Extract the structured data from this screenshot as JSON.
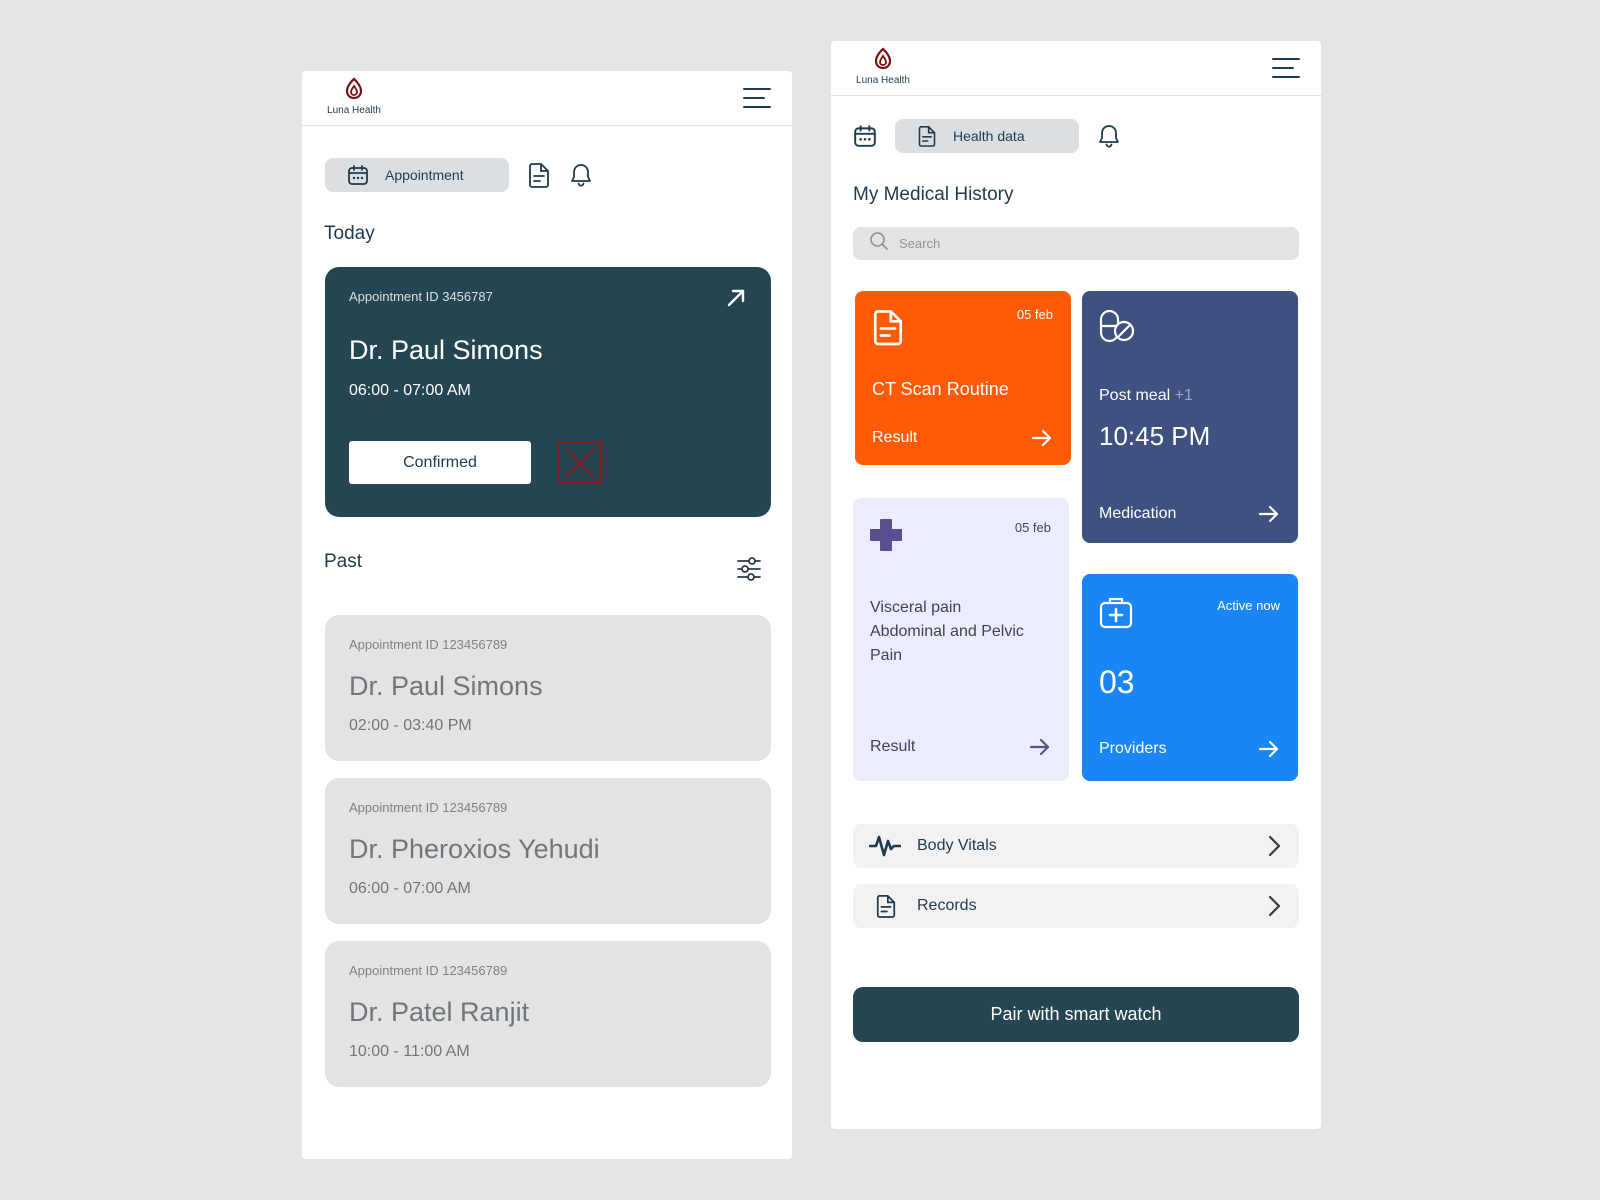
{
  "brand": {
    "name": "Luna Health",
    "logo_color": "#7a1010"
  },
  "colors": {
    "dark_teal": "#254552",
    "orange": "#ff5a06",
    "indigo": "#3f5180",
    "lavender": "#ecedfc",
    "blue": "#1a86f5",
    "cancel_red": "#8b1a1a"
  },
  "left": {
    "tabs": {
      "active_label": "Appointment",
      "active_icon": "calendar-icon",
      "other_icons": [
        "document-icon",
        "bell-icon"
      ]
    },
    "today_title": "Today",
    "today_card": {
      "appointment_id": "Appointment ID 3456787",
      "doctor": "Dr. Paul Simons",
      "time": "06:00 - 07:00 AM",
      "status_label": "Confirmed"
    },
    "past_title": "Past",
    "past": [
      {
        "appointment_id": "Appointment ID 123456789",
        "doctor": "Dr. Paul Simons",
        "time": "02:00 - 03:40 PM"
      },
      {
        "appointment_id": "Appointment ID 123456789",
        "doctor": "Dr. Pheroxios Yehudi",
        "time": "06:00 - 07:00 AM"
      },
      {
        "appointment_id": "Appointment ID 123456789",
        "doctor": "Dr. Patel Ranjit",
        "time": "10:00 - 11:00 AM"
      }
    ]
  },
  "right": {
    "tabs": {
      "active_label": "Health data",
      "active_icon": "document-icon",
      "other_icons": [
        "calendar-icon",
        "bell-icon"
      ]
    },
    "title": "My Medical History",
    "search": {
      "placeholder": "Search",
      "value": ""
    },
    "tiles": {
      "ct_scan": {
        "date": "05 feb",
        "title": "CT Scan Routine",
        "action": "Result",
        "icon": "document-icon"
      },
      "medication": {
        "title": "Post meal",
        "extra": "+1",
        "time": "10:45 PM",
        "action": "Medication",
        "icon": "pills-icon"
      },
      "visceral": {
        "date": "05 feb",
        "title": "Visceral pain Abdominal and Pelvic Pain",
        "action": "Result",
        "icon": "medical-cross-icon"
      },
      "providers": {
        "status": "Active now",
        "count": "03",
        "action": "Providers",
        "icon": "medical-kit-icon"
      }
    },
    "list": [
      {
        "label": "Body Vitals",
        "icon": "pulse-icon"
      },
      {
        "label": "Records",
        "icon": "document-icon"
      }
    ],
    "pair_button": "Pair with smart watch"
  }
}
